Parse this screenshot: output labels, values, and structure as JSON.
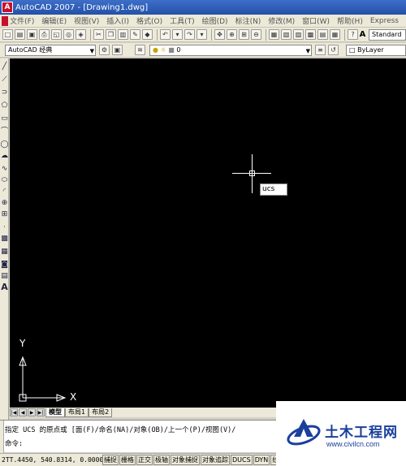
{
  "window": {
    "title": "AutoCAD 2007 - [Drawing1.dwg]"
  },
  "menu": {
    "items": [
      "文件(F)",
      "编辑(E)",
      "视图(V)",
      "插入(I)",
      "格式(O)",
      "工具(T)",
      "绘图(D)",
      "标注(N)",
      "修改(M)",
      "窗口(W)",
      "帮助(H)",
      "Express"
    ]
  },
  "toolbar_standard": {
    "text_style": "Standard"
  },
  "toolbar_layers": {
    "workspace": "AutoCAD 经典",
    "layer": "0",
    "linetype": "ByLayer"
  },
  "canvas": {
    "dynamic_input": "ucs",
    "ucs_axis_x": "X",
    "ucs_axis_y": "Y",
    "background": "#000000",
    "crosshair_color": "#ffffff"
  },
  "tabs": {
    "model": "模型",
    "layout1": "布局1",
    "layout2": "布局2"
  },
  "command": {
    "prompt_line": "指定 UCS 的原点或 [面(F)/命名(NA)/对象(OB)/上一个(P)/视图(V)/",
    "input_line": "命令:"
  },
  "status": {
    "coordinates": "2TT.4450, 540.8314, 0.0000",
    "buttons": [
      "捕捉",
      "栅格",
      "正交",
      "极轴",
      "对象捕捉",
      "对象追踪",
      "DUCS",
      "DYN",
      "线"
    ]
  },
  "watermark": {
    "name": "土木工程网",
    "url": "www.civilcn.com"
  }
}
